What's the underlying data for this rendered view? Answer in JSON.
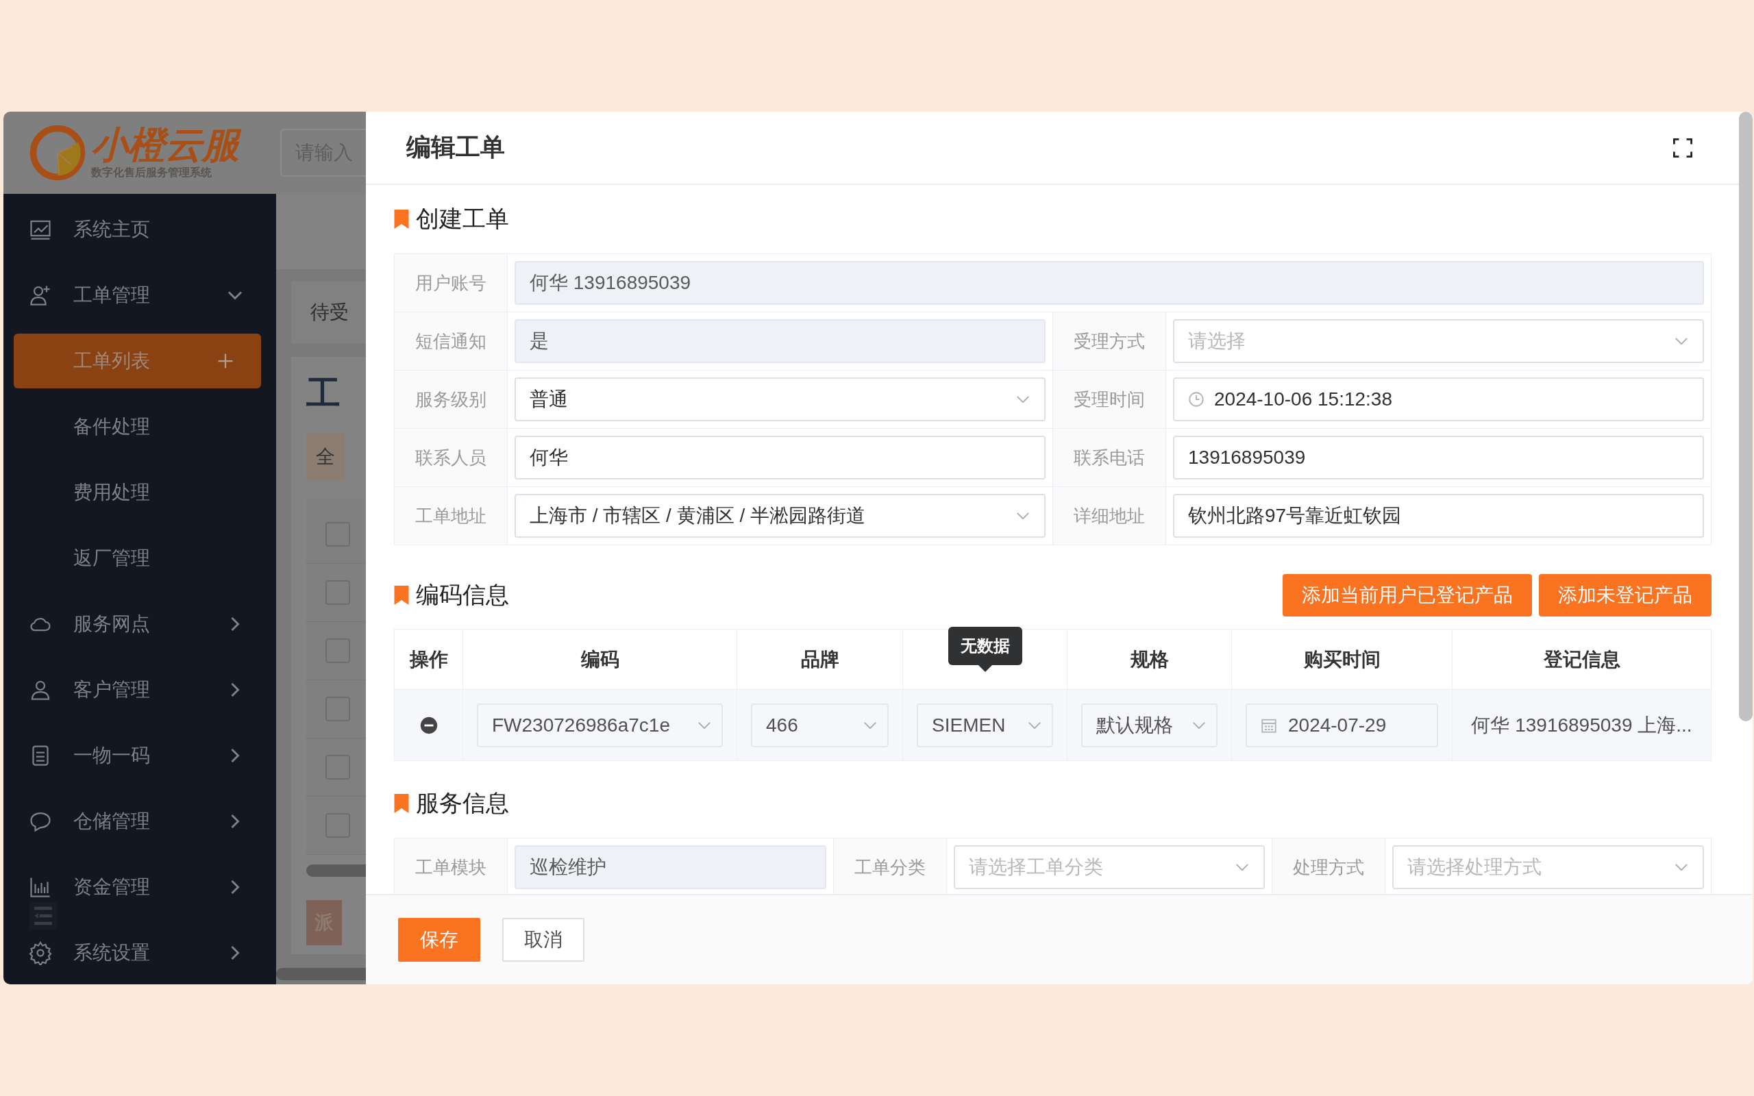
{
  "app": {
    "logo": {
      "name": "小橙云服",
      "tagline": "数字化售后服务管理系统"
    },
    "search": {
      "placeholder": "请输入"
    }
  },
  "sidebar": {
    "items": [
      {
        "label": "系统主页"
      },
      {
        "label": "工单管理",
        "expanded": true,
        "children": [
          {
            "label": "工单列表",
            "selected": true
          },
          {
            "label": "备件处理",
            "selected": false
          },
          {
            "label": "费用处理",
            "selected": false
          },
          {
            "label": "返厂管理",
            "selected": false
          }
        ]
      },
      {
        "label": "服务网点",
        "expanded": false
      },
      {
        "label": "客户管理",
        "expanded": false
      },
      {
        "label": "一物一码",
        "expanded": false
      },
      {
        "label": "仓储管理",
        "expanded": false
      },
      {
        "label": "资金管理",
        "expanded": false
      },
      {
        "label": "系统设置",
        "expanded": false
      }
    ]
  },
  "background": {
    "tab": "待受",
    "title": "工",
    "filter": "全",
    "action": "派",
    "rows": [
      {
        "checked": false
      },
      {
        "checked": false
      },
      {
        "checked": false
      },
      {
        "checked": false
      },
      {
        "checked": false
      },
      {
        "checked": false
      }
    ]
  },
  "dialog": {
    "title": "编辑工单",
    "sections": [
      {
        "kind": "form",
        "title": "创建工单",
        "rows": [
          [
            {
              "label": "用户账号",
              "kind": "text",
              "value": "何华 13916895039",
              "disabled": true
            }
          ],
          [
            {
              "label": "短信通知",
              "kind": "text",
              "value": "是",
              "disabled": true
            },
            {
              "label": "受理方式",
              "kind": "select",
              "placeholder": "请选择",
              "disabled": false
            }
          ],
          [
            {
              "label": "服务级别",
              "kind": "select",
              "value": "普通",
              "disabled": false
            },
            {
              "label": "受理时间",
              "kind": "datetime",
              "value": "2024-10-06 15:12:38",
              "disabled": false
            }
          ],
          [
            {
              "label": "联系人员",
              "kind": "text",
              "value": "何华",
              "disabled": false
            },
            {
              "label": "联系电话",
              "kind": "text",
              "value": "13916895039",
              "disabled": false
            }
          ],
          [
            {
              "label": "工单地址",
              "kind": "select",
              "value": "上海市 / 市辖区 / 黄浦区 / 半淞园路街道",
              "disabled": false
            },
            {
              "label": "详细地址",
              "kind": "text",
              "value": "钦州北路97号靠近虹钦园",
              "disabled": false
            }
          ]
        ]
      },
      {
        "kind": "table",
        "title": "编码信息",
        "buttons": [
          "添加当前用户已登记产品",
          "添加未登记产品"
        ],
        "columns": [
          {
            "label": "操作"
          },
          {
            "label": "编码"
          },
          {
            "label": "品牌"
          },
          {
            "tooltip": "无数据"
          },
          {
            "label": "规格"
          },
          {
            "label": "购买时间"
          },
          {
            "label": "登记信息"
          }
        ],
        "rows": [
          [
            {
              "kind": "remove"
            },
            {
              "kind": "select",
              "value": "FW230726986a7c1e"
            },
            {
              "kind": "select",
              "value": "466"
            },
            {
              "kind": "select",
              "value": "SIEMEN"
            },
            {
              "kind": "select",
              "value": "默认规格"
            },
            {
              "kind": "date",
              "value": "2024-07-29"
            },
            {
              "kind": "text",
              "value": "何华 13916895039 上海..."
            }
          ]
        ]
      },
      {
        "kind": "form",
        "title": "服务信息",
        "rows": [
          [
            {
              "label": "工单模块",
              "kind": "text",
              "value": "巡检维护",
              "disabled": true
            },
            {
              "label": "工单分类",
              "kind": "select",
              "placeholder": "请选择工单分类",
              "disabled": false
            },
            {
              "label": "处理方式",
              "kind": "select",
              "placeholder": "请选择处理方式",
              "disabled": false
            }
          ]
        ]
      }
    ],
    "footer": {
      "buttons": [
        {
          "label": "保存",
          "kind": "primary"
        },
        {
          "label": "取消",
          "kind": "default"
        }
      ]
    }
  }
}
